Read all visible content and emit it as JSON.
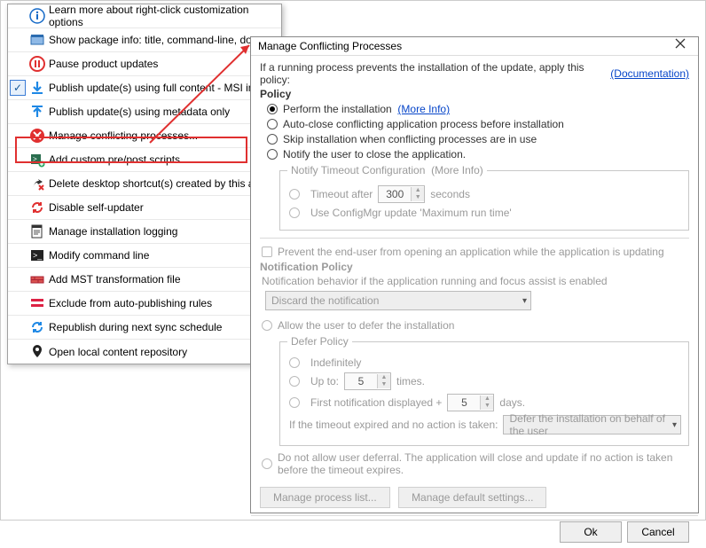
{
  "menu": {
    "items": [
      {
        "label": "Learn more about right-click customization options",
        "icon": "info"
      },
      {
        "label": "Show package info: title, command-line, dow",
        "icon": "package"
      },
      {
        "label": "Pause product updates",
        "icon": "pause"
      },
      {
        "label": "Publish update(s) using full content - MSI in",
        "icon": "download",
        "checked": true
      },
      {
        "label": "Publish update(s) using metadata only",
        "icon": "upload"
      },
      {
        "label": "Manage conflicting processes...",
        "icon": "stop"
      },
      {
        "label": "Add custom pre/post scripts",
        "icon": "script"
      },
      {
        "label": "Delete desktop shortcut(s) created by this ap",
        "icon": "delete"
      },
      {
        "label": "Disable self-updater",
        "icon": "refresh-off"
      },
      {
        "label": "Manage installation logging",
        "icon": "log"
      },
      {
        "label": "Modify command line",
        "icon": "terminal"
      },
      {
        "label": "Add MST transformation file",
        "icon": "brick"
      },
      {
        "label": "Exclude from auto-publishing rules",
        "icon": "exclude"
      },
      {
        "label": "Republish during next sync schedule",
        "icon": "sync"
      },
      {
        "label": "Open local content repository",
        "icon": "location"
      }
    ]
  },
  "dialog": {
    "title": "Manage Conflicting Processes",
    "intro": "If a running process prevents the installation of the update, apply this policy:",
    "doc_link": "(Documentation)",
    "policy_heading": "Policy",
    "opt_perform": "Perform the installation",
    "more_info": "(More Info)",
    "opt_autoclose": "Auto-close conflicting application process before installation",
    "opt_skip": "Skip installation when conflicting processes are in use",
    "opt_notify": "Notify the user to close the application.",
    "notify_fs_title": "Notify Timeout Configuration",
    "notify_more_info": "(More Info)",
    "timeout_after": "Timeout after",
    "timeout_value": "300",
    "seconds": "seconds",
    "use_configmgr": "Use ConfigMgr update 'Maximum run time'",
    "prevent_open": "Prevent the end-user from opening an application while the application is updating",
    "notif_policy_heading": "Notification Policy",
    "notif_behavior": "Notification behavior if the application running and focus assist is enabled",
    "notif_dropdown": "Discard the notification",
    "allow_defer": "Allow the user to defer the installation",
    "defer_fs_title": "Defer Policy",
    "defer_indef": "Indefinitely",
    "defer_upto": "Up to:",
    "defer_upto_val": "5",
    "defer_times": "times.",
    "defer_firstnotify": "First notification displayed +",
    "defer_firstnotify_val": "5",
    "defer_days": "days.",
    "defer_timeout_label": "If the timeout expired and no action is taken:",
    "defer_timeout_dd": "Defer the installation on behalf of the user",
    "no_defer": "Do not allow user deferral. The application will close and update if no action is taken before the timeout expires.",
    "btn_manage_process": "Manage process list...",
    "btn_manage_defaults": "Manage default settings...",
    "btn_ok": "Ok",
    "btn_cancel": "Cancel"
  }
}
